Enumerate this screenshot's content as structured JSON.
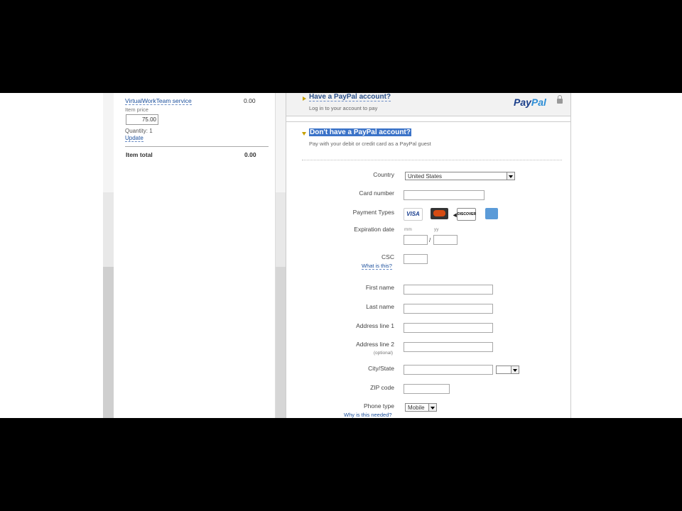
{
  "cart": {
    "item_name": "VirtualWorkTeam service",
    "item_amount": "0.00",
    "item_price_label": "Item price",
    "item_price_value": "75.00",
    "quantity": "Quantity: 1",
    "update_link": "Update",
    "total_label": "Item total",
    "total_value": "0.00"
  },
  "have_account": {
    "title": "Have a PayPal account?",
    "subtitle": "Log in to your account to pay",
    "logo_text": "Pay",
    "logo_text2": "Pal"
  },
  "guest": {
    "title": "Don't have a PayPal account?",
    "subtitle": "Pay with your debit or credit card as a PayPal guest"
  },
  "form": {
    "country_label": "Country",
    "country_value": "United States",
    "card_number_label": "Card number",
    "payment_types_label": "Payment Types",
    "cards": [
      "VISA",
      "MasterCard",
      "DISCOVER",
      "AMERICAN EXPRESS"
    ],
    "expiration_label": "Expiration date",
    "mm": "mm",
    "yy": "yy",
    "slash": "/",
    "csc_label": "CSC",
    "csc_help": "What is this?",
    "first_name_label": "First name",
    "last_name_label": "Last name",
    "address1_label": "Address line 1",
    "address2_label": "Address line 2",
    "optional": "(optional)",
    "city_state_label": "City/State",
    "zip_label": "ZIP code",
    "phone_type_label": "Phone type",
    "phone_type_value": "Mobile",
    "phone_help": "Why is this needed?"
  }
}
